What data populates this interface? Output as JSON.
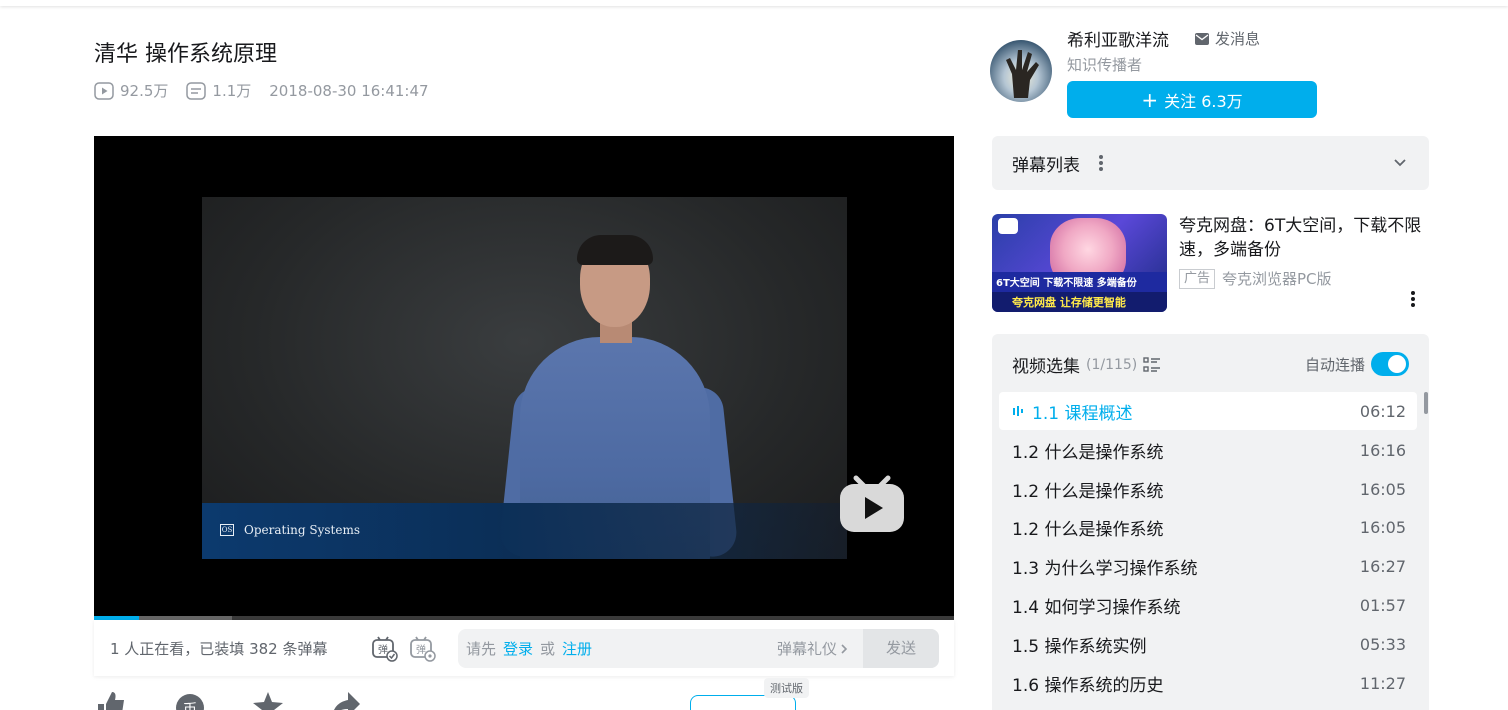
{
  "video": {
    "title": "清华 操作系统原理",
    "plays": "92.5万",
    "danmaku_count": "1.1万",
    "publish_time": "2018-08-30 16:41:47",
    "progress": 0.052,
    "buffered": 0.16,
    "banner_text": "Operating Systems",
    "banner_logo": "OS"
  },
  "danmaku_bar": {
    "viewers": "1 人正在看，已装填 382 条弹幕",
    "hint_prefix": "请先",
    "login": "登录",
    "or": "或",
    "register": "注册",
    "etiquette": "弹幕礼仪",
    "send": "发送"
  },
  "beta_tag": "测试版",
  "uploader": {
    "name": "希利亚歌洋流",
    "message": "发消息",
    "description": "知识传播者",
    "follow_label": "关注 6.3万"
  },
  "danmaku_list": {
    "label": "弹幕列表"
  },
  "ad": {
    "title": "夸克网盘：6T大空间，下载不限速，多端备份",
    "tag": "广告",
    "source": "夸克浏览器PC版",
    "thumb_line1": "6T大空间 下载不限速 多端备份",
    "thumb_line2": "夸克网盘 让存储更智能"
  },
  "playlist": {
    "heading": "视频选集",
    "count": "(1/115)",
    "autoplay_label": "自动连播",
    "autoplay_on": true,
    "episodes": [
      {
        "title": "1.1 课程概述",
        "duration": "06:12",
        "active": true
      },
      {
        "title": "1.2 什么是操作系统",
        "duration": "16:16"
      },
      {
        "title": "1.2 什么是操作系统",
        "duration": "16:05"
      },
      {
        "title": "1.2 什么是操作系统",
        "duration": "16:05"
      },
      {
        "title": "1.3 为什么学习操作系统",
        "duration": "16:27"
      },
      {
        "title": "1.4 如何学习操作系统",
        "duration": "01:57"
      },
      {
        "title": "1.5 操作系统实例",
        "duration": "05:33"
      },
      {
        "title": "1.6 操作系统的历史",
        "duration": "11:27"
      }
    ]
  },
  "colors": {
    "accent": "#00aeec",
    "panel": "#f1f2f3",
    "muted": "#9499a0"
  }
}
